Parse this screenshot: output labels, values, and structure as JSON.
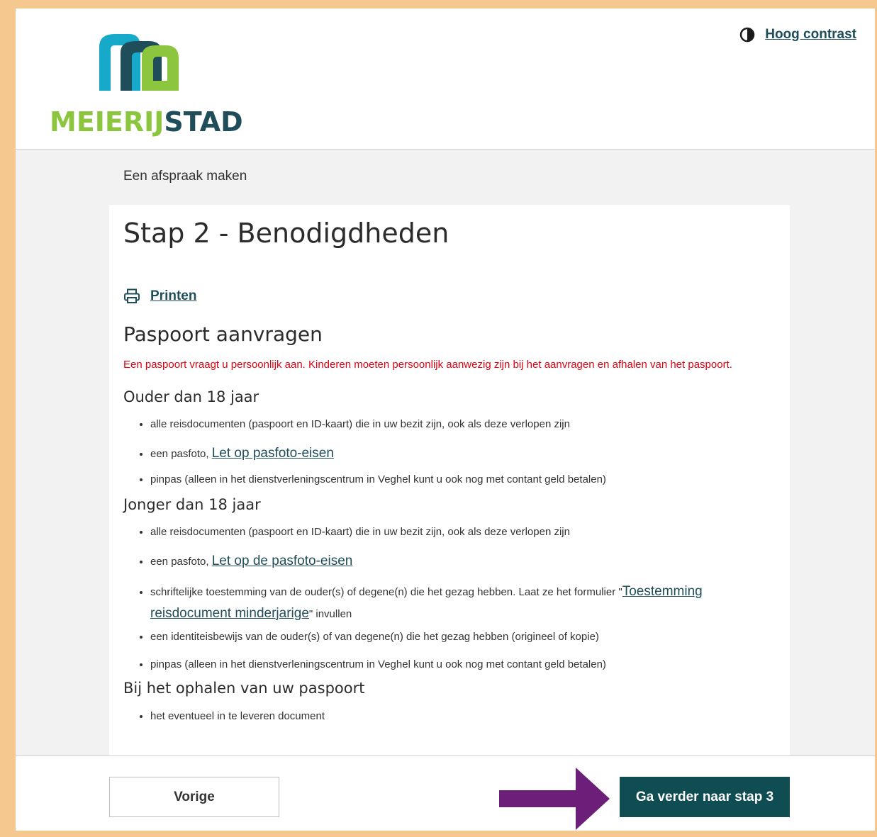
{
  "header": {
    "logo_text_a": "MEIERIJ",
    "logo_text_b": "STAD",
    "contrast_label": "Hoog contrast"
  },
  "breadcrumb": "Een afspraak maken",
  "card": {
    "title": "Stap 2 - Benodigdheden",
    "print_label": "Printen",
    "section_title": "Paspoort aanvragen",
    "warning": "Een paspoort vraagt u persoonlijk aan. Kinderen moeten persoonlijk aanwezig zijn bij het aanvragen en afhalen van het paspoort.",
    "older": {
      "title": "Ouder dan 18 jaar",
      "items": [
        "alle reisdocumenten (paspoort en ID-kaart) die in uw bezit zijn, ook als deze verlopen zijn",
        "een pasfoto, ",
        "pinpas (alleen in het dienstverleningscentrum in Veghel kunt u ook nog met contant geld betalen)"
      ],
      "link": "Let op pasfoto-eisen"
    },
    "younger": {
      "title": "Jonger dan 18 jaar",
      "items": [
        "alle reisdocumenten (paspoort en ID-kaart) die in uw bezit zijn, ook als deze verlopen zijn",
        "een pasfoto, ",
        "schriftelijke toestemming van de ouder(s) of degene(n) die het gezag hebben. Laat ze het formulier \"",
        "\" invullen",
        "een identiteisbewijs van de ouder(s) of van degene(n) die het gezag hebben (origineel of kopie)",
        "pinpas (alleen in het dienstverleningscentrum in Veghel kunt u ook nog met contant geld betalen)"
      ],
      "link_photo": "Let op de pasfoto-eisen",
      "link_form": "Toestemming reisdocument minderjarige"
    },
    "pickup": {
      "title": "Bij het ophalen van uw paspoort",
      "items": [
        "het eventueel in te leveren document"
      ]
    }
  },
  "footer": {
    "prev_label": "Vorige",
    "next_label": "Ga verder naar stap 3"
  },
  "colors": {
    "brand_green": "#8cc63f",
    "brand_dark": "#1f4e5a",
    "warning_red": "#e3000f",
    "button_dark": "#0f4d52",
    "arrow_purple": "#6b1f78"
  }
}
